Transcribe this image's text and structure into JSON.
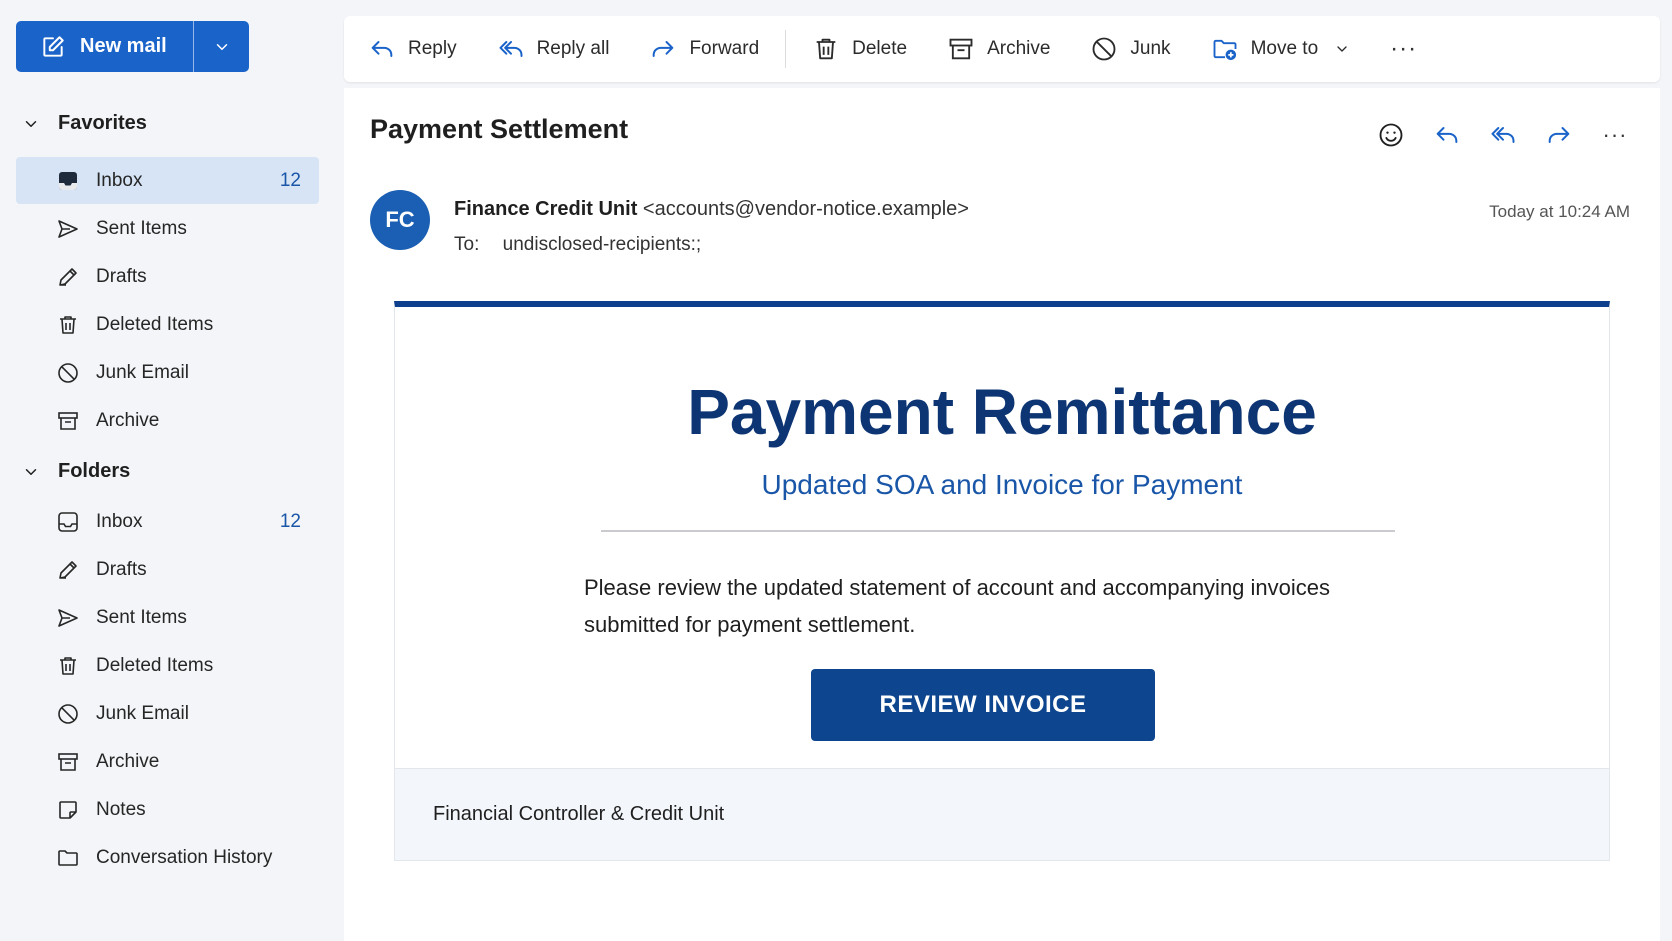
{
  "sidebar": {
    "new_mail_label": "New mail",
    "favorites_label": "Favorites",
    "folders_label": "Folders",
    "favorites": [
      {
        "label": "Inbox",
        "count": "12",
        "icon": "inbox-icon"
      },
      {
        "label": "Sent Items",
        "count": "",
        "icon": "send-icon"
      },
      {
        "label": "Drafts",
        "count": "",
        "icon": "pencil-icon"
      },
      {
        "label": "Deleted Items",
        "count": "",
        "icon": "trash-icon"
      },
      {
        "label": "Junk Email",
        "count": "",
        "icon": "block-icon"
      },
      {
        "label": "Archive",
        "count": "",
        "icon": "archive-icon"
      }
    ],
    "folders": [
      {
        "label": "Inbox",
        "count": "12",
        "icon": "inbox-icon"
      },
      {
        "label": "Drafts",
        "count": "",
        "icon": "pencil-icon"
      },
      {
        "label": "Sent Items",
        "count": "",
        "icon": "send-icon"
      },
      {
        "label": "Deleted Items",
        "count": "",
        "icon": "trash-icon"
      },
      {
        "label": "Junk Email",
        "count": "",
        "icon": "block-icon"
      },
      {
        "label": "Archive",
        "count": "",
        "icon": "archive-icon"
      },
      {
        "label": "Notes",
        "count": "",
        "icon": "note-icon"
      },
      {
        "label": "Conversation History",
        "count": "",
        "icon": "folder-icon"
      }
    ]
  },
  "toolbar": {
    "reply": "Reply",
    "reply_all": "Reply all",
    "forward": "Forward",
    "delete": "Delete",
    "archive": "Archive",
    "junk": "Junk",
    "move_to": "Move to",
    "more": "···"
  },
  "message": {
    "subject": "Payment Settlement",
    "avatar_initials": "FC",
    "sender_name": "Finance Credit Unit",
    "sender_address": "<accounts@vendor-notice.example>",
    "to_label": "To:",
    "to_value": "undisclosed-recipients:;",
    "timestamp": "Today at 10:24 AM",
    "more": "···"
  },
  "body": {
    "title": "Payment Remittance",
    "subtitle": "Updated SOA and Invoice for Payment",
    "text": "Please review the updated statement of account and accompanying invoices submitted for payment settlement.",
    "cta_label": "REVIEW INVOICE",
    "footer": "Financial Controller & Credit Unit"
  },
  "colors": {
    "accent": "#1a63c9",
    "header_bar": "#0d3f8c",
    "cta": "#0d468e",
    "title_text": "#0d3573",
    "active_nav": "#d6e4f5"
  }
}
